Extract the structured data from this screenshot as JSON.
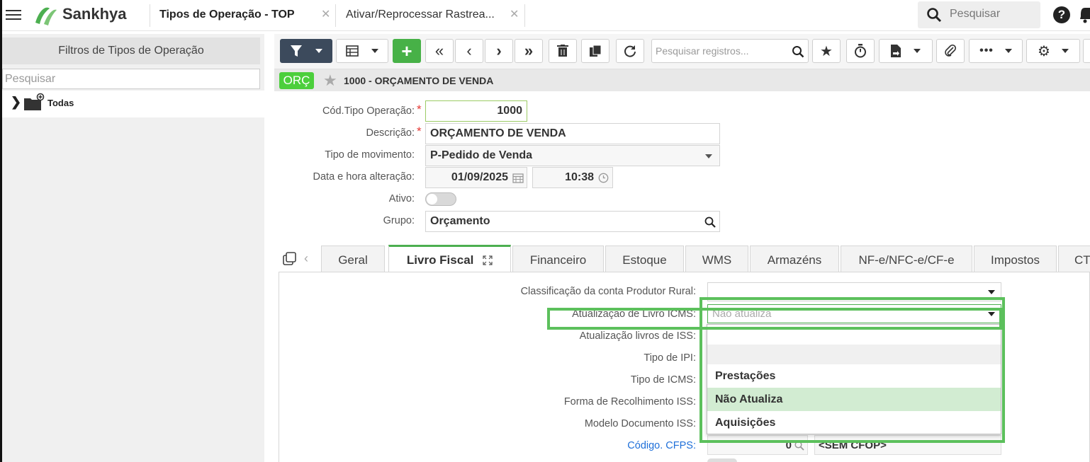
{
  "brand": {
    "name": "Sankhya",
    "logo_color": "#4caf50"
  },
  "top_tabs": [
    {
      "label": "Tipos de Operação - TOP"
    },
    {
      "label": "Ativar/Reprocessar Rastrea..."
    }
  ],
  "global_search": {
    "placeholder": "Pesquisar"
  },
  "left_panel": {
    "title": "Filtros de Tipos de Operação",
    "search_placeholder": "Pesquisar",
    "tree": [
      {
        "label": "Todas"
      }
    ]
  },
  "toolbar": {
    "record_search_placeholder": "Pesquisar registros...",
    "icons": [
      "filter-icon",
      "grid-icon",
      "add-icon",
      "first-icon",
      "prev-icon",
      "next-icon",
      "last-icon",
      "delete-icon",
      "copy-icon",
      "refresh-icon",
      "search-icon",
      "star-icon",
      "timer-icon",
      "document-icon",
      "attach-icon",
      "more-icon",
      "gear-icon"
    ]
  },
  "record": {
    "badge": "ORÇ",
    "badge_color": "#4ccf3c",
    "title": "1000 - ORÇAMENTO DE VENDA"
  },
  "form": {
    "cod_label": "Cód.Tipo Operação:",
    "cod_value": "1000",
    "desc_label": "Descrição:",
    "desc_value": "ORÇAMENTO DE VENDA",
    "tipo_mov_label": "Tipo de movimento:",
    "tipo_mov_value": "P-Pedido de Venda",
    "data_label": "Data e hora alteração:",
    "data_value": "01/09/2025",
    "hora_value": "10:38",
    "ativo_label": "Ativo:",
    "ativo_on": false,
    "grupo_label": "Grupo:",
    "grupo_value": "Orçamento",
    "required_mark": "*"
  },
  "tabs": [
    {
      "label": "Geral"
    },
    {
      "label": "Livro Fiscal"
    },
    {
      "label": "Financeiro"
    },
    {
      "label": "Estoque"
    },
    {
      "label": "WMS"
    },
    {
      "label": "Armazéns"
    },
    {
      "label": "NF-e/NFC-e/CF-e"
    },
    {
      "label": "Impostos"
    },
    {
      "label": "CT"
    }
  ],
  "active_tab": "Livro Fiscal",
  "livro_fiscal": {
    "classificacao_label": "Classificação da conta Produtor Rural:",
    "classificacao_value": "",
    "atualizacao_icms_label": "Atualização de Livro ICMS:",
    "atualizacao_icms_value": "Não atualiza",
    "atualizacao_iss_label": "Atualização livros de ISS:",
    "tipo_ipi_label": "Tipo de IPI:",
    "tipo_icms_label": "Tipo de ICMS:",
    "forma_recolhimento_label": "Forma de Recolhimento ISS:",
    "modelo_doc_label": "Modelo Documento ISS:",
    "codigo_cfps_label": "Código. CFPS:",
    "codigo_cfps_value": "0",
    "sem_cfop": "<SEM CFOP>"
  },
  "dropdown": {
    "options": [
      {
        "label": ""
      },
      {
        "label": "Prestações"
      },
      {
        "label": "Não Atualiza"
      },
      {
        "label": "Aquisições"
      }
    ],
    "highlighted": "Não Atualiza"
  },
  "highlight_color": "#5cc05c"
}
